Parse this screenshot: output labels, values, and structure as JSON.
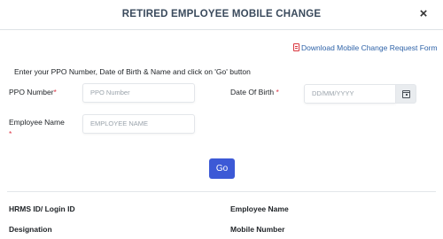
{
  "modal": {
    "title": "RETIRED EMPLOYEE MOBILE CHANGE",
    "close_glyph": "×"
  },
  "download_link": {
    "icon": "pdf-file-icon",
    "label": "Download Mobile Change Request Form"
  },
  "instruction": "Enter your PPO Number, Date of Birth & Name and click on 'Go' button",
  "form": {
    "ppo": {
      "label": "PPO Number",
      "required_mark": "*",
      "placeholder": "PPO Number"
    },
    "dob": {
      "label": "Date Of Birth",
      "required_mark": "*",
      "placeholder": "DD/MM/YYYY",
      "icon": "calendar-icon"
    },
    "name": {
      "label": "Employee Name",
      "required_mark": "*",
      "placeholder": "EMPLOYEE NAME"
    },
    "go_label": "Go"
  },
  "details": {
    "hrms_label": "HRMS ID/ Login ID",
    "emp_name_label": "Employee Name",
    "designation_label": "Designation",
    "mobile_label": "Mobile Number"
  },
  "colors": {
    "primary_button": "#3c59d6",
    "link": "#2f63a8",
    "required": "#dc3545",
    "pdf_icon": "#d9363e"
  }
}
